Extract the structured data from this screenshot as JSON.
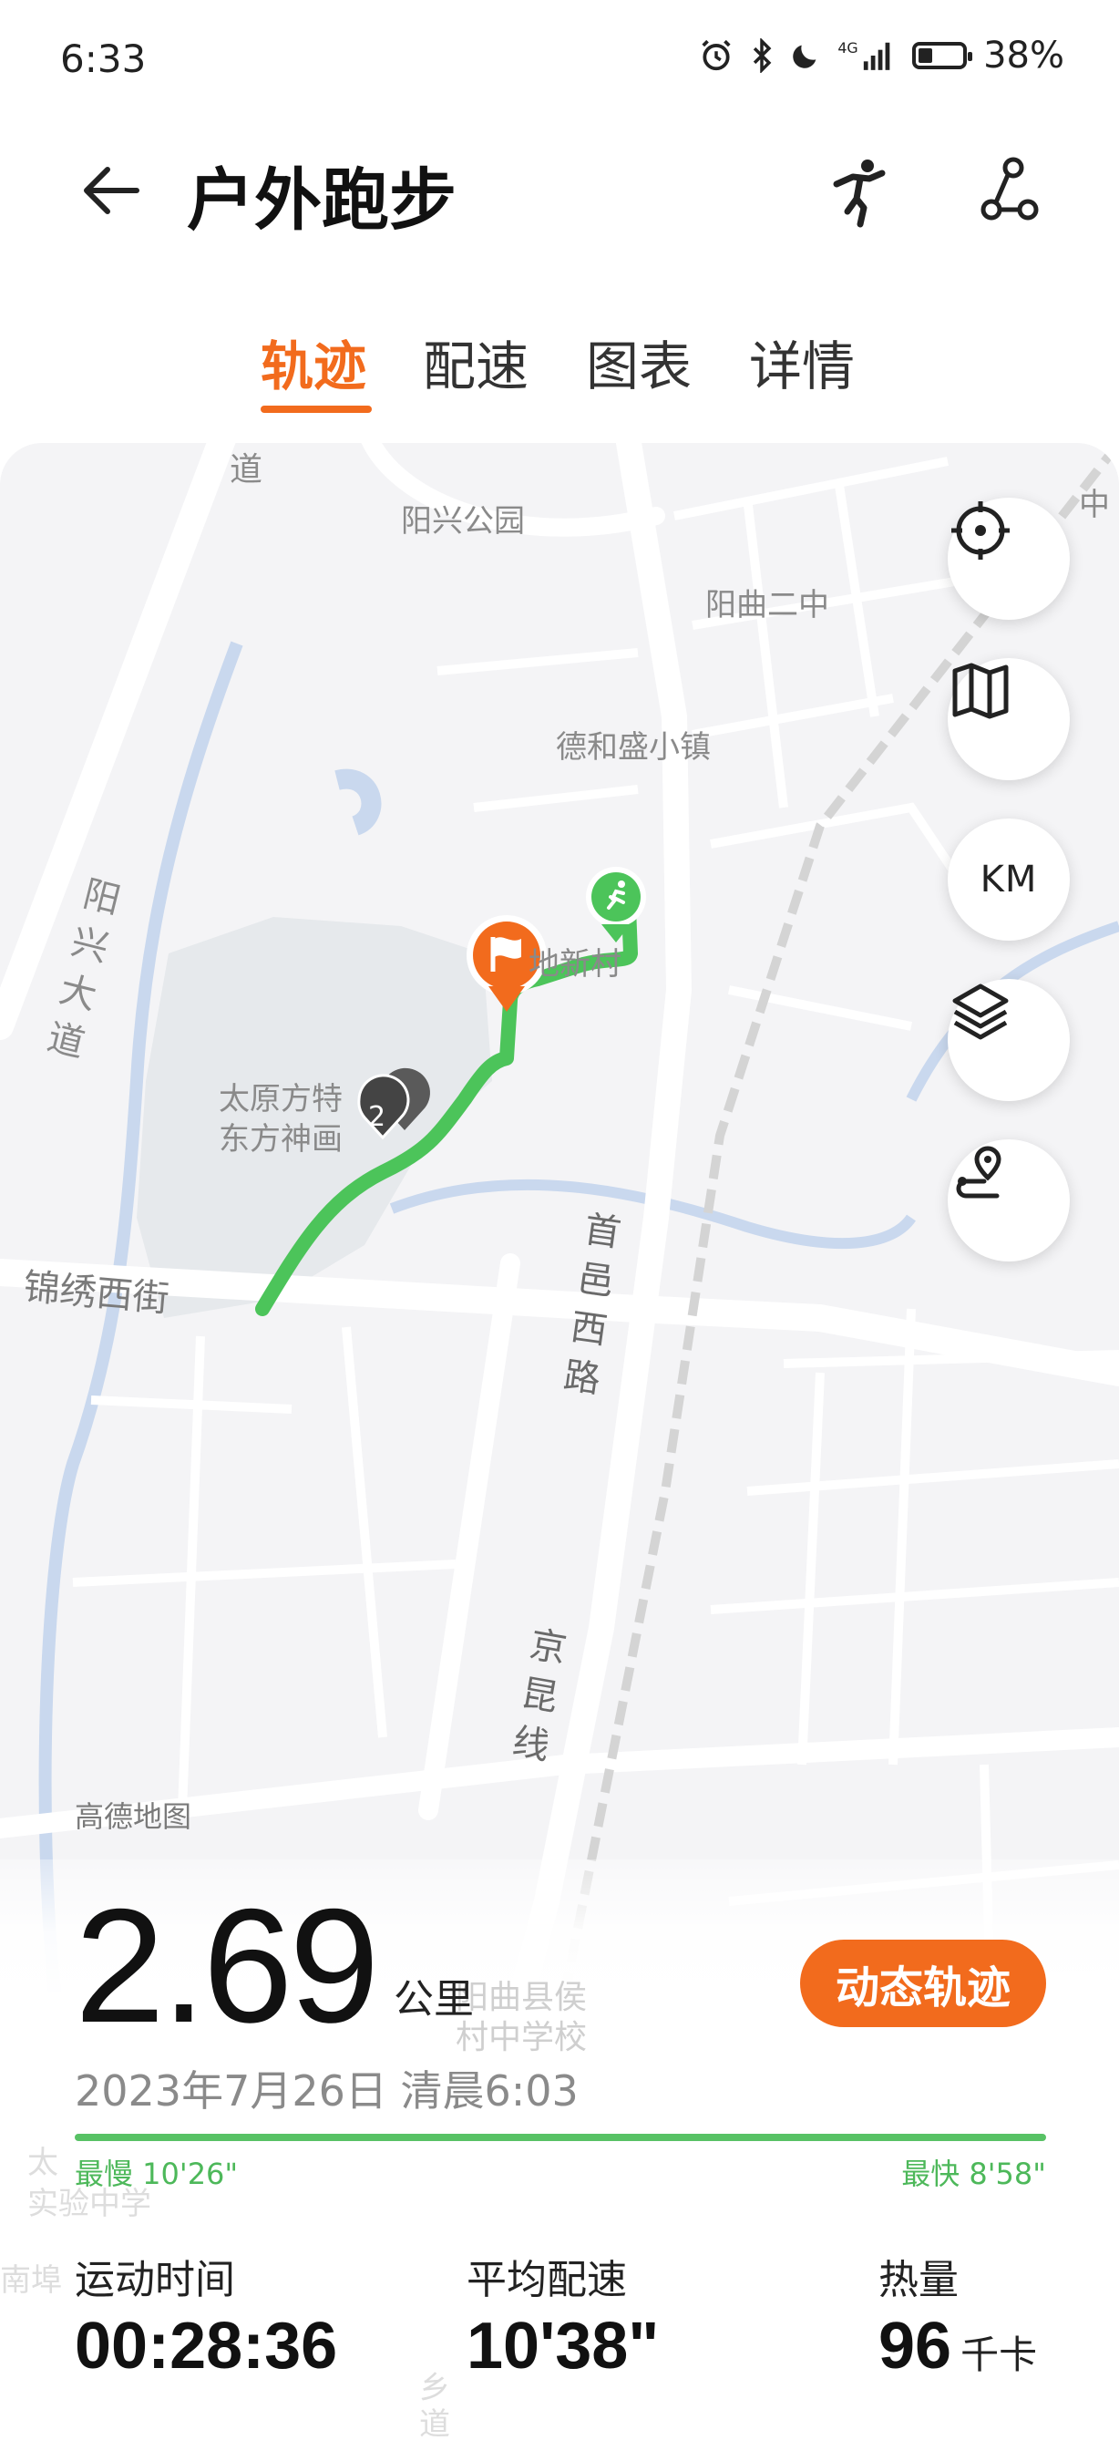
{
  "status_bar": {
    "time": "6:33",
    "battery_percent": "38%",
    "signal": "4G"
  },
  "header": {
    "title": "户外跑步",
    "icons": [
      "back-arrow-icon",
      "runner-pose-icon",
      "share-route-icon"
    ]
  },
  "tabs": [
    {
      "label": "轨迹",
      "active": true
    },
    {
      "label": "配速",
      "active": false
    },
    {
      "label": "图表",
      "active": false
    },
    {
      "label": "详情",
      "active": false
    }
  ],
  "map": {
    "labels": {
      "road_top": "道",
      "park": "阳兴公园",
      "school2": "阳曲二中",
      "town": "德和盛小镇",
      "village": "地新村",
      "area1": "太原方特",
      "area2": "东方神画",
      "yangxing_road": "阳兴大道",
      "jinxiu_street": "锦绣西街",
      "shouyi_road": "首邑西路",
      "jingkun_line": "京昆线",
      "edge_top_right": "中",
      "faded_school": "阳曲县侯村中学校",
      "faded_left": "太",
      "faded_left2": "实验中学",
      "faded_bottom": "南埠",
      "faded_xiang": "乡道"
    },
    "brand": "高德地图",
    "marker_count": "2",
    "controls": [
      "locate-icon",
      "map-icon",
      "KM",
      "layers-icon",
      "route-pin-icon"
    ],
    "km_label": "KM",
    "accent_color": "#f26b1d",
    "route_color": "#4cc45a"
  },
  "summary": {
    "distance": "2.69",
    "distance_unit": "公里",
    "replay_label": "动态轨迹",
    "datetime": "2023年7月26日 清晨6:03",
    "slowest_label": "最慢 10'26\"",
    "fastest_label": "最快 8'58\""
  },
  "stats": [
    {
      "label": "运动时间",
      "value": "00:28:36",
      "unit": ""
    },
    {
      "label": "平均配速",
      "value": "10'38\"",
      "unit": ""
    },
    {
      "label": "热量",
      "value": "96",
      "unit": "千卡"
    }
  ]
}
